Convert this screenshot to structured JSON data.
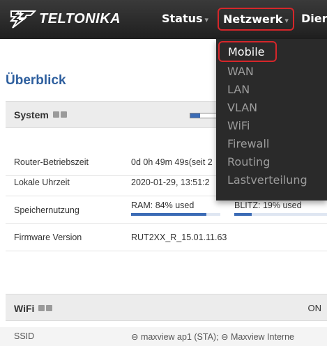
{
  "brand": {
    "logo_text": "TELTONIKA"
  },
  "nav": {
    "status_label": "Status",
    "netzwerk_label": "Netzwerk",
    "dienste_label": "Dier",
    "caret": "▾"
  },
  "network_menu": {
    "items": [
      "Mobile",
      "WAN",
      "LAN",
      "VLAN",
      "WiFi",
      "Firewall",
      "Routing",
      "Lastverteilung"
    ],
    "selected": "Mobile"
  },
  "page": {
    "title": "Überblick"
  },
  "system": {
    "title": "System",
    "rows": [
      {
        "label": "Router-Betriebszeit",
        "value": "0d 0h 49m 49s(seit 2"
      },
      {
        "label": "Lokale Uhrzeit",
        "value": "2020-01-29, 13:51:2"
      },
      {
        "label": "Speichernutzung",
        "value": "RAM: 84% used",
        "value2": "BLITZ: 19% used",
        "ram_pct": 84,
        "flash_pct": 19
      },
      {
        "label": "Firmware Version",
        "value": "RUT2XX_R_15.01.11.63"
      }
    ]
  },
  "wifi": {
    "title": "WiFi",
    "status": "ON",
    "ssid_label": "SSID",
    "ssid_value": "⊖ maxview ap1 (STA); ⊖ Maxview Interne"
  },
  "colors": {
    "accent_blue": "#2e5f9e",
    "highlight_red": "#d5262a",
    "nav_bg": "#2a2a2a"
  }
}
